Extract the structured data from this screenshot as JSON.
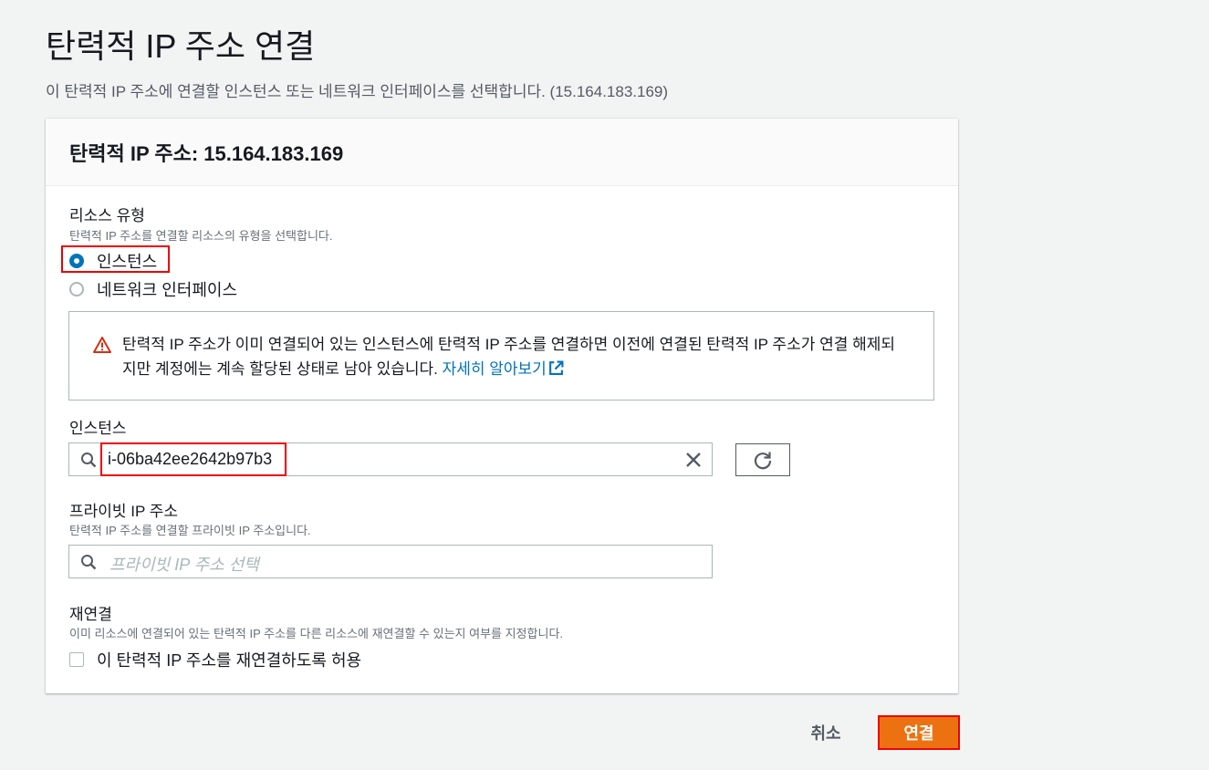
{
  "page": {
    "title": "탄력적 IP 주소 연결",
    "description": "이 탄력적 IP 주소에 연결할 인스턴스 또는 네트워크 인터페이스를 선택합니다. (15.164.183.169)"
  },
  "card": {
    "header": "탄력적 IP 주소: 15.164.183.169",
    "resource_type": {
      "label": "리소스 유형",
      "hint": "탄력적 IP 주소를 연결할 리소스의 유형을 선택합니다.",
      "options": [
        {
          "label": "인스턴스",
          "selected": true
        },
        {
          "label": "네트워크 인터페이스",
          "selected": false
        }
      ]
    },
    "alert": {
      "text": "탄력적 IP 주소가 이미 연결되어 있는 인스턴스에 탄력적 IP 주소를 연결하면 이전에 연결된 탄력적 IP 주소가 연결 해제되지만 계정에는 계속 할당된 상태로 남아 있습니다.",
      "link": "자세히 알아보기"
    },
    "instance": {
      "label": "인스턴스",
      "value": "i-06ba42ee2642b97b3"
    },
    "private_ip": {
      "label": "프라이빗 IP 주소",
      "hint": "탄력적 IP 주소를 연결할 프라이빗 IP 주소입니다.",
      "placeholder": "프라이빗 IP 주소 선택"
    },
    "reassociate": {
      "label": "재연결",
      "hint": "이미 리소스에 연결되어 있는 탄력적 IP 주소를 다른 리소스에 재연결할 수 있는지 여부를 지정합니다.",
      "checkbox_label": "이 탄력적 IP 주소를 재연결하도록 허용",
      "checked": false
    }
  },
  "footer": {
    "cancel": "취소",
    "submit": "연결"
  },
  "colors": {
    "primary": "#ec7211",
    "link": "#0073bb",
    "highlight": "#ee0000",
    "warning": "#d13212"
  }
}
